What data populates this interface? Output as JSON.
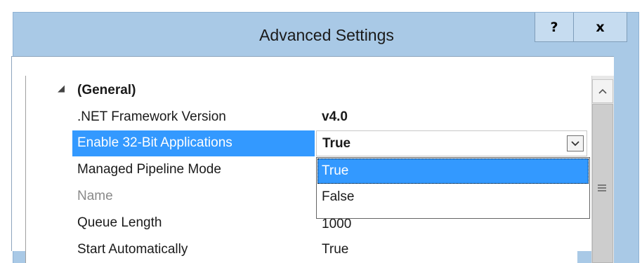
{
  "window": {
    "title": "Advanced Settings",
    "help_label": "?",
    "close_label": "x",
    "frame_color": "#a9c9e6"
  },
  "grid": {
    "category": "(General)",
    "properties": [
      {
        "name": ".NET Framework Version",
        "value": "v4.0"
      },
      {
        "name": "Enable 32-Bit Applications",
        "value": "True"
      },
      {
        "name": "Managed Pipeline Mode",
        "value": ""
      },
      {
        "name": "Name",
        "value": ""
      },
      {
        "name": "Queue Length",
        "value": "1000"
      },
      {
        "name": "Start Automatically",
        "value": "True"
      }
    ],
    "selection_color": "#3399ff"
  },
  "dropdown": {
    "selected_value": "True",
    "options": [
      "True",
      "False"
    ]
  },
  "icons": {
    "expander": "collapse-triangle-icon",
    "combo_arrow": "chevron-down-icon",
    "scroll_up": "chevron-up-icon",
    "scroll_grip": "grip-icon"
  }
}
